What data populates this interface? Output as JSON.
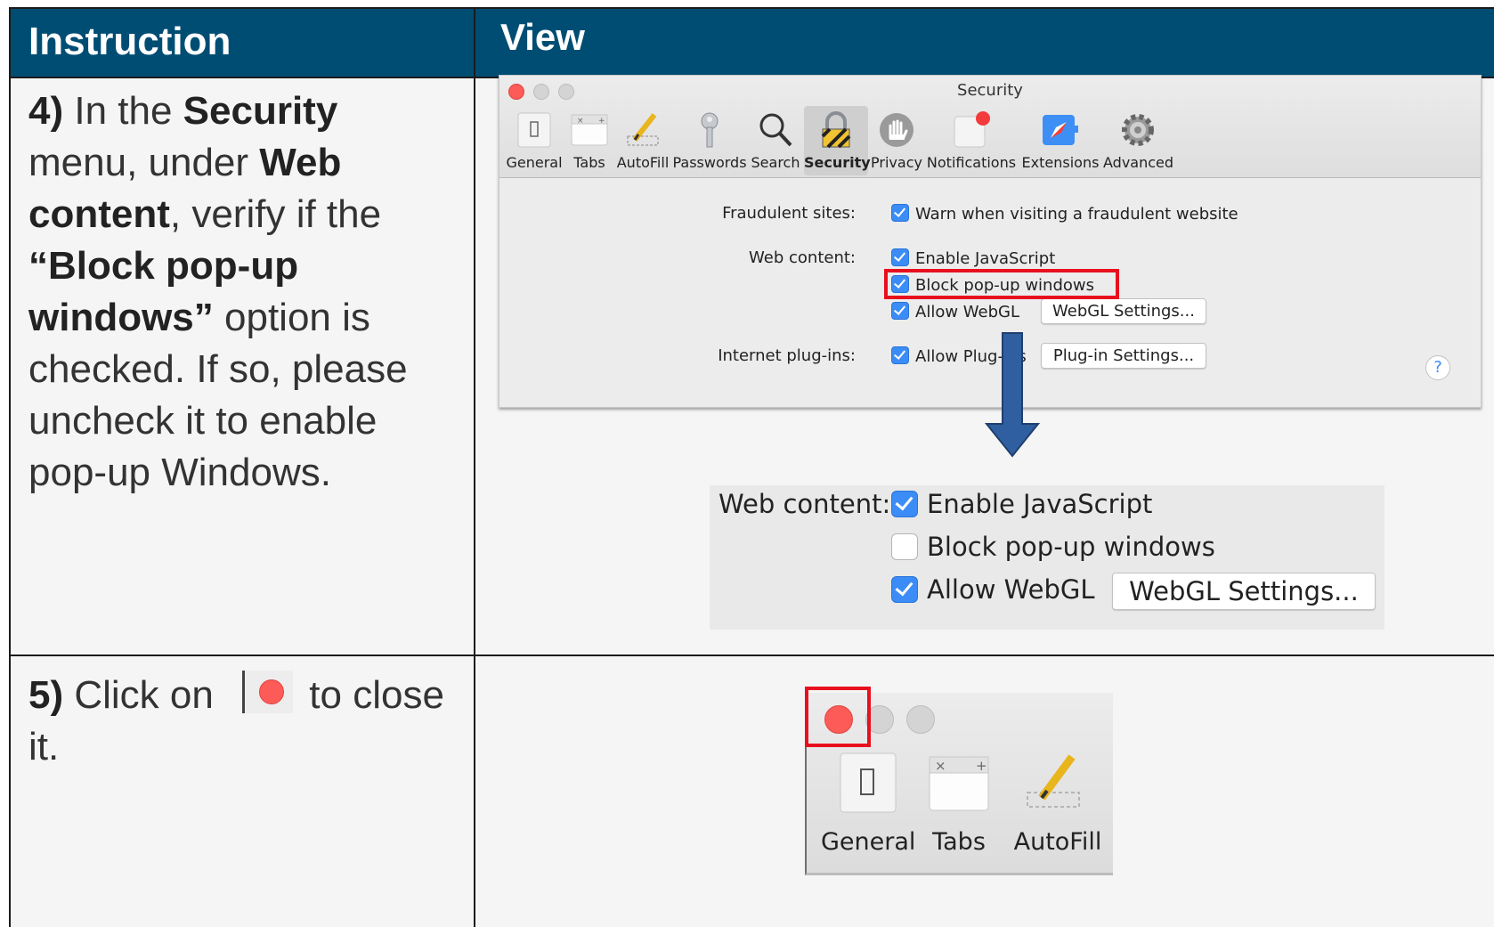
{
  "header": {
    "instruction": "Instruction",
    "view": "View"
  },
  "steps": {
    "s4": {
      "num": "4)",
      "t1": " In the ",
      "b1": "Security",
      "t2": " menu, under ",
      "b2": "Web content",
      "t3": ", verify if the ",
      "b3": "“Block pop-up windows”",
      "t4": " option is checked. If so, please uncheck it to enable pop-up Windows."
    },
    "s5": {
      "num": "5)",
      "t1": " Click on ",
      "t2": " to close it."
    }
  },
  "window": {
    "title": "Security",
    "toolbar": [
      "General",
      "Tabs",
      "AutoFill",
      "Passwords",
      "Search",
      "Security",
      "Privacy",
      "Notifications",
      "Extensions",
      "Advanced"
    ],
    "active_tab": "Security",
    "fraud_label": "Fraudulent sites:",
    "fraud_option": "Warn when visiting a fraudulent website",
    "web_label": "Web content:",
    "js_option": "Enable JavaScript",
    "popup_option": "Block pop-up windows",
    "webgl_option": "Allow WebGL",
    "webgl_button": "WebGL Settings...",
    "plugins_label": "Internet plug-ins:",
    "plugins_option": "Allow Plug-ins",
    "plugins_button": "Plug-in Settings...",
    "help": "?"
  },
  "zoom": {
    "web_label": "Web content:",
    "js_option": "Enable JavaScript",
    "popup_option": "Block pop-up windows",
    "webgl_option": "Allow WebGL",
    "webgl_button": "WebGL Settings...",
    "popup_checked": false
  },
  "corner": {
    "items": [
      "General",
      "Tabs",
      "AutoFill"
    ]
  },
  "colors": {
    "header_bg": "#004d74",
    "highlight": "#e8101f",
    "close_red": "#fc5b57",
    "checkbox_blue": "#3b8cf6",
    "arrow_blue": "#2f5fa0"
  }
}
